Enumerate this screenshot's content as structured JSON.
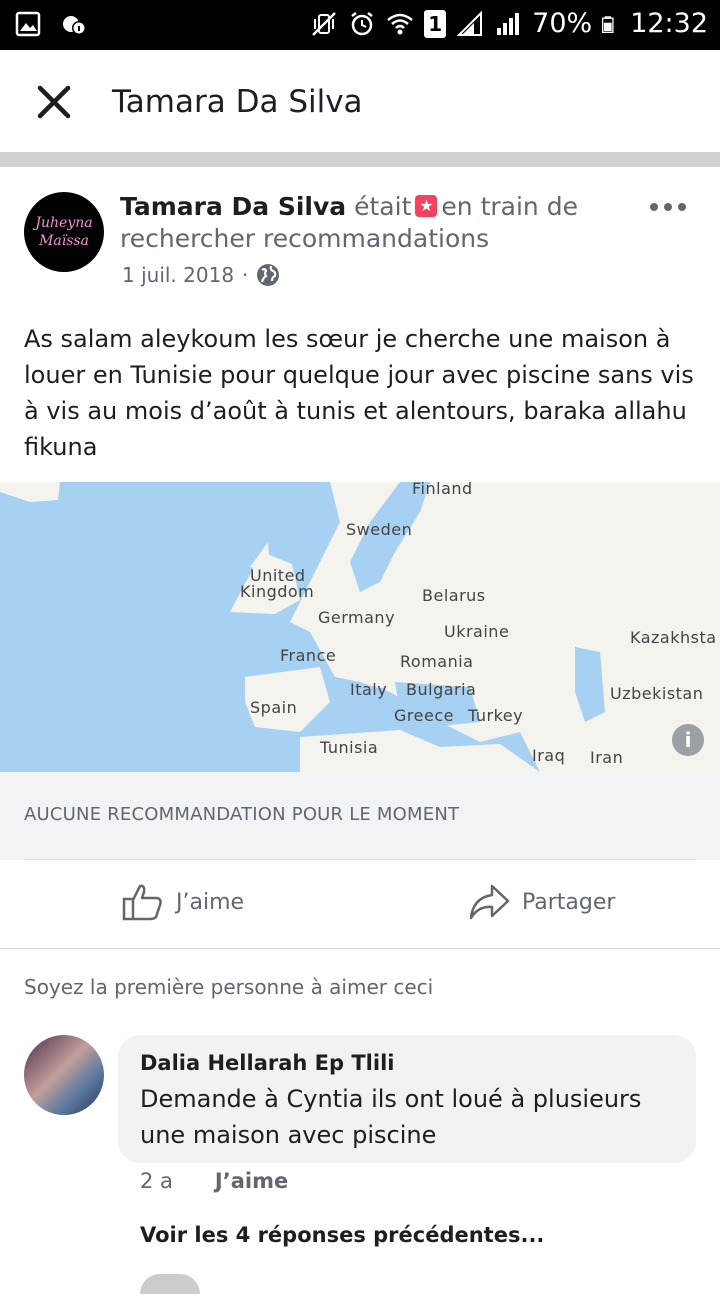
{
  "status_bar": {
    "battery": "70%",
    "time": "12:32",
    "sim_slot": "1"
  },
  "header": {
    "title": "Tamara Da Silva"
  },
  "post": {
    "author": "Tamara Da Silva",
    "avatar_text": [
      "Juheyna",
      "Maïssa"
    ],
    "status_prefix": "était",
    "status_suffix": "en train de rechercher recommandations",
    "date": "1 juil. 2018",
    "body": "As salam aleykoum les sœur je cherche une maison à louer en Tunisie pour quelque jour avec piscine sans vis à vis au mois d’août à tunis et alentours, baraka allahu fikuna"
  },
  "map": {
    "labels": [
      "Finland",
      "Sweden",
      "United",
      "Kingdom",
      "Belarus",
      "Germany",
      "Ukraine",
      "Kazakhsta",
      "France",
      "Romania",
      "Italy",
      "Bulgaria",
      "Uzbekistan",
      "Spain",
      "Greece",
      "Turkey",
      "Tunisia",
      "Iraq",
      "Iran"
    ],
    "info_glyph": "i"
  },
  "recommendations": {
    "empty_text": "AUCUNE RECOMMANDATION POUR LE MOMENT"
  },
  "actions": {
    "like": "J’aime",
    "share": "Partager"
  },
  "reactions": {
    "first_like_text": "Soyez la première personne à aimer ceci"
  },
  "comment": {
    "author": "Dalia Hellarah Ep Tlili",
    "text": "Demande à Cyntia ils ont loué à plusieurs une maison avec piscine",
    "age": "2 a",
    "like": "J’aime",
    "view_replies": "Voir les 4 réponses précédentes..."
  }
}
